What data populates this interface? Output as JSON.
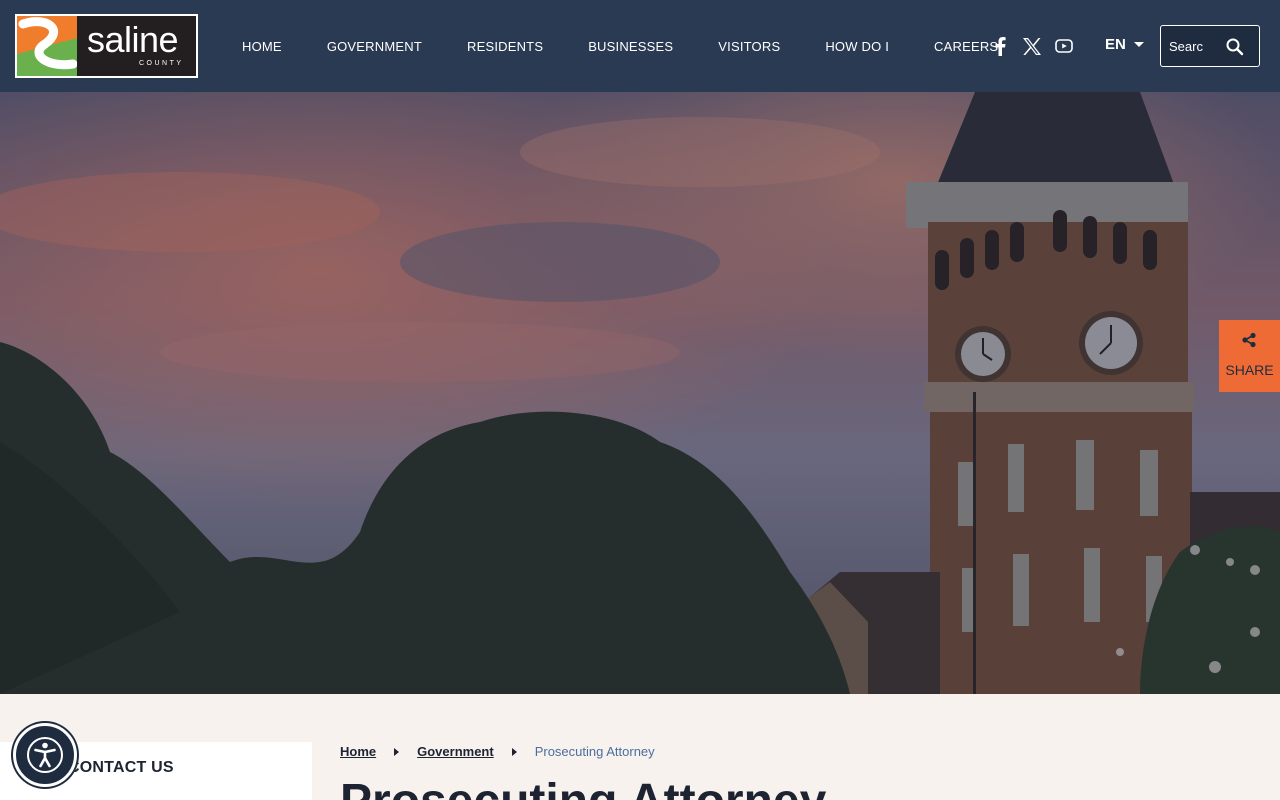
{
  "site": {
    "logo_text": "saline",
    "logo_subtext": "COUNTY"
  },
  "nav": {
    "items": [
      {
        "label": "HOME"
      },
      {
        "label": "GOVERNMENT"
      },
      {
        "label": "RESIDENTS"
      },
      {
        "label": "BUSINESSES"
      },
      {
        "label": "VISITORS"
      },
      {
        "label": "HOW DO I"
      },
      {
        "label": "CAREERS"
      }
    ]
  },
  "social": {
    "icons": [
      "facebook-icon",
      "x-icon",
      "youtube-icon"
    ]
  },
  "language": {
    "current": "EN"
  },
  "search": {
    "placeholder": "Search"
  },
  "share": {
    "label": "SHARE"
  },
  "sidebar": {
    "title": "CONTACT US"
  },
  "breadcrumb": {
    "home": "Home",
    "parent": "Government",
    "current": "Prosecuting Attorney"
  },
  "page": {
    "title": "Prosecuting Attorney"
  },
  "colors": {
    "header_bg": "#2a3a52",
    "accent_orange": "#ef6b35",
    "accent_green": "#6ab04c",
    "page_bg": "#f7f2ee",
    "text_dark": "#1d2330",
    "link_blue": "#4b6ea0"
  }
}
